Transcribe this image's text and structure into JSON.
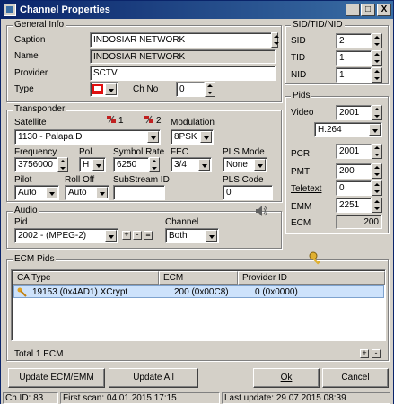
{
  "window": {
    "title": "Channel Properties",
    "minimize": "_",
    "maximize": "□",
    "close": "X"
  },
  "general": {
    "title": "General Info",
    "caption_label": "Caption",
    "caption_value": "INDOSIAR NETWORK",
    "name_label": "Name",
    "name_value": "INDOSIAR NETWORK",
    "provider_label": "Provider",
    "provider_value": "SCTV",
    "type_label": "Type",
    "chno_label": "Ch No",
    "chno_value": "0"
  },
  "sid": {
    "title": "SID/TID/NID",
    "sid_label": "SID",
    "sid_value": "2",
    "tid_label": "TID",
    "tid_value": "1",
    "nid_label": "NID",
    "nid_value": "1"
  },
  "transponder": {
    "title": "Transponder",
    "satellite_label": "Satellite",
    "satellite_value": "1130 - Palapa D",
    "sat1": "1",
    "sat2": "2",
    "modulation_label": "Modulation",
    "modulation_value": "8PSK",
    "frequency_label": "Frequency",
    "frequency_value": "3756000",
    "pol_label": "Pol.",
    "pol_value": "H",
    "symbol_label": "Symbol Rate",
    "symbol_value": "6250",
    "fec_label": "FEC",
    "fec_value": "3/4",
    "plsmode_label": "PLS Mode",
    "plsmode_value": "None",
    "pilot_label": "Pilot",
    "pilot_value": "Auto",
    "rolloff_label": "Roll Off",
    "rolloff_value": "Auto",
    "substream_label": "SubStream ID",
    "substream_value": "",
    "plscode_label": "PLS Code",
    "plscode_value": "0"
  },
  "pids": {
    "title": "Pids",
    "video_label": "Video",
    "video_value": "2001",
    "codec_value": "H.264",
    "pcr_label": "PCR",
    "pcr_value": "2001",
    "pmt_label": "PMT",
    "pmt_value": "200",
    "teletext_label": "Teletext",
    "teletext_value": "0",
    "emm_label": "EMM",
    "emm_value": "2251",
    "ecm_label": "ECM",
    "ecm_value": "200"
  },
  "audio": {
    "title": "Audio",
    "pid_label": "Pid",
    "pid_value": "2002 -   (MPEG-2)",
    "channel_label": "Channel",
    "channel_value": "Both"
  },
  "ecm": {
    "title": "ECM Pids",
    "columns": [
      "CA Type",
      "ECM",
      "Provider ID"
    ],
    "row": {
      "ca_type": "19153 (0x4AD1) XCrypt",
      "ecm": "200 (0x00C8)",
      "provider": "0 (0x0000)"
    },
    "total": "Total 1 ECM"
  },
  "buttons": {
    "update_ecm_emm": "Update ECM/EMM",
    "update_all": "Update All",
    "ok": "Ok",
    "cancel": "Cancel"
  },
  "status": {
    "chid": "Ch.ID: 83",
    "first_scan": "First scan: 04.01.2015 17:15",
    "last_update": "Last update: 29.07.2015 08:39"
  },
  "colors": {
    "title_start": "#0a246a",
    "title_end": "#3a6ea5",
    "selection": "#cde2fb",
    "type_icon": "#e01010"
  }
}
